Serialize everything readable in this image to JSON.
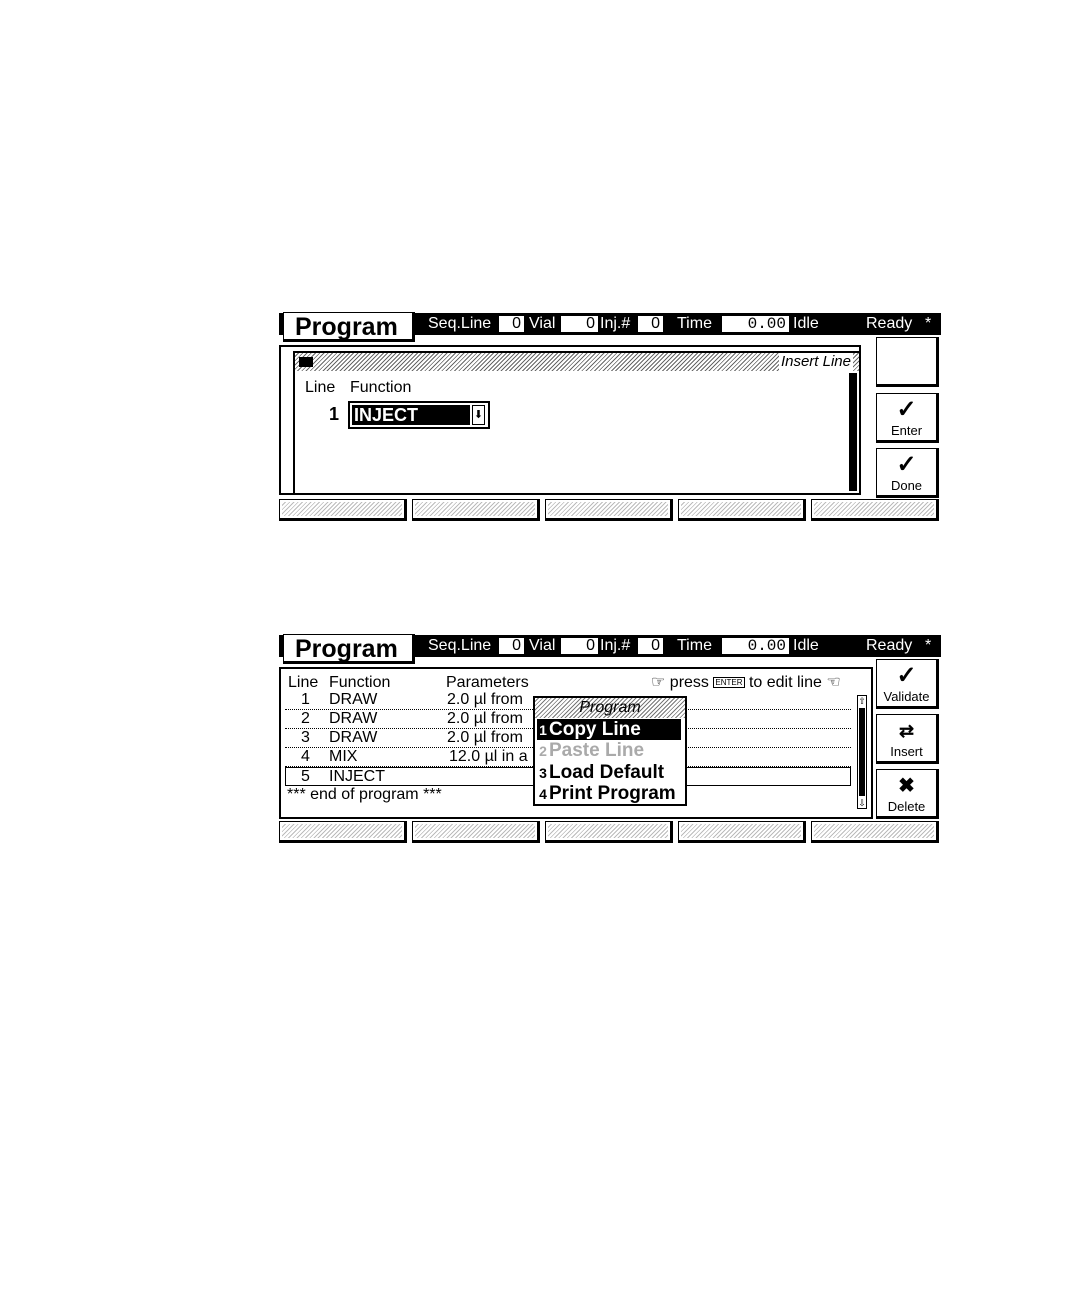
{
  "header": {
    "title": "Program",
    "seq_line_label": "Seq.Line",
    "seq_line_value": "0",
    "vial_label": "Vial",
    "vial_value": "0",
    "inj_label": "Inj.#",
    "inj_value": "0",
    "time_label": "Time",
    "time_value": "0.00",
    "idle_label": "Idle",
    "status": "Ready",
    "status_mark": "*"
  },
  "screen1": {
    "dialog_title": "Insert Line",
    "col_line": "Line",
    "col_function": "Function",
    "line_number": "1",
    "function_value": "INJECT",
    "side_keys": [
      {
        "label": "",
        "icon": "blank"
      },
      {
        "label": "Enter",
        "icon": "check-icon"
      },
      {
        "label": "Done",
        "icon": "check-icon"
      }
    ]
  },
  "screen2": {
    "col_line": "Line",
    "col_function": "Function",
    "col_parameters": "Parameters",
    "hint_press": "press",
    "hint_key": "ENTER",
    "hint_rest": "to edit line",
    "rows": [
      {
        "line": "1",
        "function": "DRAW",
        "params": "2.0 µl from"
      },
      {
        "line": "2",
        "function": "DRAW",
        "params": "2.0 µl from"
      },
      {
        "line": "3",
        "function": "DRAW",
        "params": "2.0 µl from"
      },
      {
        "line": "4",
        "function": "MIX",
        "params": "12.0 µl in a"
      },
      {
        "line": "5",
        "function": "INJECT",
        "params": ""
      }
    ],
    "end_text": "*** end of program ***",
    "menu": {
      "title": "Program",
      "items": [
        {
          "num": "1",
          "label": "Copy Line",
          "state": "active"
        },
        {
          "num": "2",
          "label": "Paste Line",
          "state": "disabled"
        },
        {
          "num": "3",
          "label": "Load Default",
          "state": "normal"
        },
        {
          "num": "4",
          "label": "Print Program",
          "state": "normal"
        }
      ]
    },
    "side_keys": [
      {
        "label": "Validate",
        "icon": "check-icon"
      },
      {
        "label": "Insert",
        "icon": "insert-icon"
      },
      {
        "label": "Delete",
        "icon": "delete-icon"
      }
    ]
  }
}
